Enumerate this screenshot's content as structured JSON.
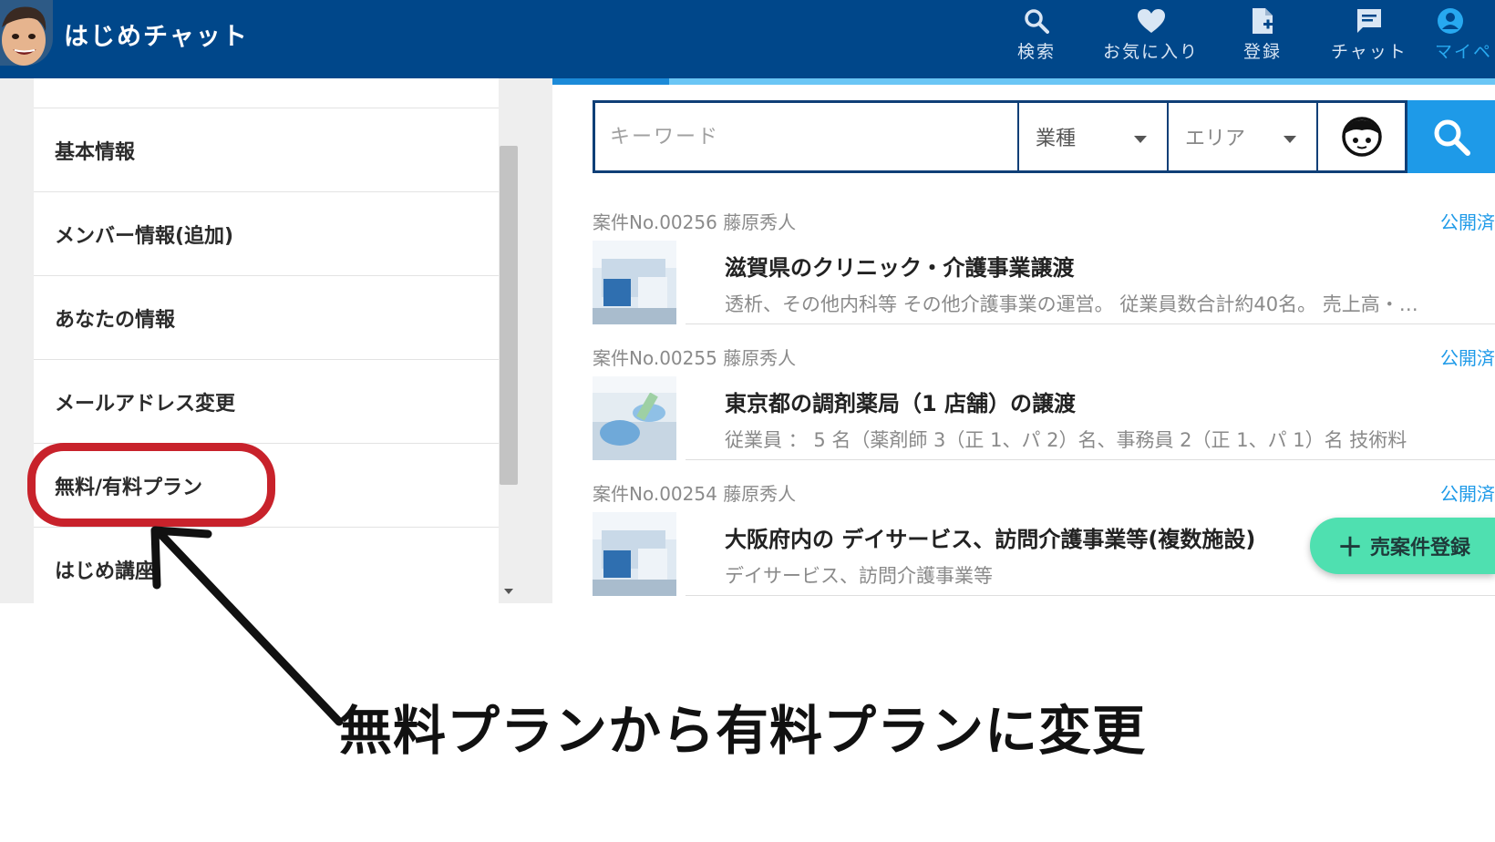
{
  "header": {
    "app_title": "はじめチャット",
    "nav": {
      "search": "検索",
      "favorite": "お気に入り",
      "register": "登録",
      "chat": "チャット",
      "mypage": "マイペ"
    }
  },
  "sidebar": {
    "items": [
      {
        "label": "基本情報"
      },
      {
        "label": "メンバー情報(追加)"
      },
      {
        "label": "あなたの情報"
      },
      {
        "label": "メールアドレス変更"
      },
      {
        "label": "無料/有料プラン"
      },
      {
        "label": "はじめ講座"
      }
    ]
  },
  "search": {
    "keyword_placeholder": "キーワード",
    "industry_label": "業種",
    "area_label": "エリア"
  },
  "listings": [
    {
      "case_no": "案件No.00256",
      "owner": "藤原秀人",
      "status": "公開済",
      "title": "滋賀県のクリニック・介護事業譲渡",
      "description": "透析、その他内科等 その他介護事業の運営。 従業員数合計約40名。 売上高・収益は"
    },
    {
      "case_no": "案件No.00255",
      "owner": "藤原秀人",
      "status": "公開済",
      "title": "東京都の調剤薬局（1 店舗）の譲渡",
      "description": "従業員 ： 5 名（薬剤師 3（正 1、パ 2）名、事務員 2（正 1、パ 1）名 技術料"
    },
    {
      "case_no": "案件No.00254",
      "owner": "藤原秀人",
      "status": "公開済",
      "title": "大阪府内の デイサービス、訪問介護事業等(複数施設)",
      "description": "デイサービス、訪問介護事業等"
    }
  ],
  "fab": {
    "plus": "＋",
    "label": "売案件登録"
  },
  "annotation": "無料プランから有料プランに変更",
  "colors": {
    "header_bg": "#00478a",
    "accent_blue": "#1e9ae8",
    "highlight_red": "#c8222b",
    "fab_green": "#4fe0b0"
  }
}
